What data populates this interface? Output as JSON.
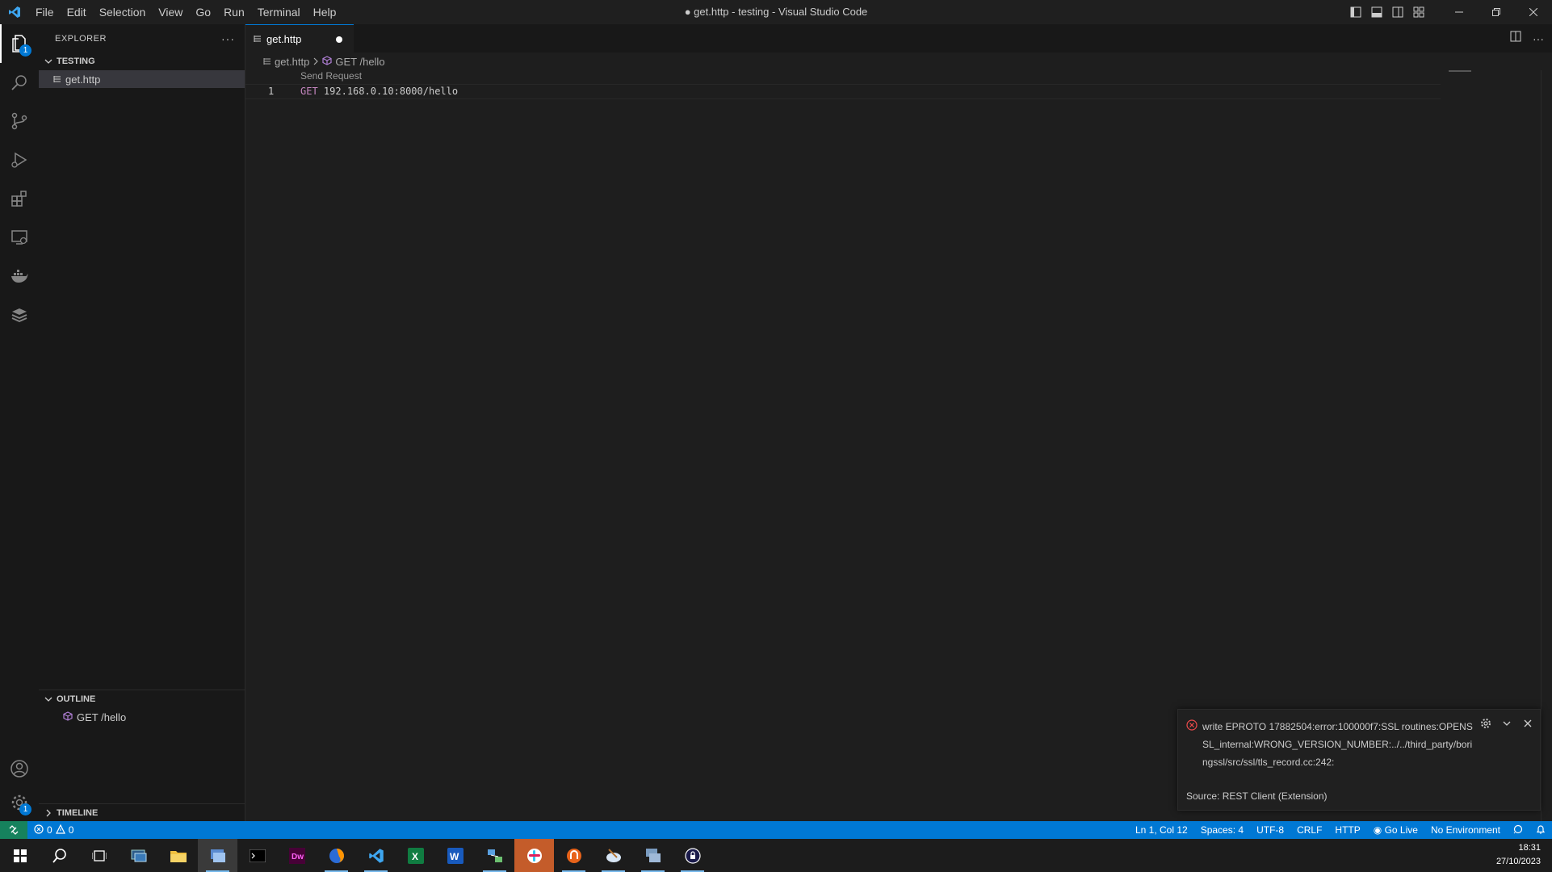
{
  "titlebar": {
    "menu": [
      "File",
      "Edit",
      "Selection",
      "View",
      "Go",
      "Run",
      "Terminal",
      "Help"
    ],
    "window_title": "● get.http - testing - Visual Studio Code",
    "window_controls": [
      "minimize-icon",
      "restore-icon",
      "close-icon"
    ]
  },
  "activitybar": {
    "items": [
      "explorer-icon",
      "search-icon",
      "source-control-icon",
      "run-debug-icon",
      "extensions-icon",
      "remote-explorer-icon",
      "docker-icon",
      "database-icon"
    ],
    "explorer_badge": "1",
    "accounts_icon": "accounts-icon",
    "manage_badge": "1"
  },
  "sidebar": {
    "title": "EXPLORER",
    "more": "···",
    "folder": "TESTING",
    "files": [
      "get.http"
    ],
    "outline_title": "OUTLINE",
    "outline_items": [
      "GET /hello"
    ],
    "timeline_title": "TIMELINE"
  },
  "tabs": [
    {
      "label": "get.http",
      "dirty": true
    }
  ],
  "breadcrumb": {
    "file": "get.http",
    "symbol": "GET /hello"
  },
  "editor": {
    "codelens": "Send Request",
    "lines": [
      {
        "number": "1",
        "method": "GET",
        "url": "192.168.0.10:8000/hello"
      }
    ]
  },
  "notification": {
    "message": "write EPROTO 17882504:error:100000f7:SSL routines:OPENSSL_internal:WRONG_VERSION_NUMBER:../../third_party/boringssl/src/ssl/tls_record.cc:242:",
    "source": "Source: REST Client (Extension)"
  },
  "statusbar": {
    "errors": "0",
    "warnings": "0",
    "position": "Ln 1, Col 12",
    "spaces": "Spaces: 4",
    "encoding": "UTF-8",
    "eol": "CRLF",
    "language": "HTTP",
    "golive": "Go Live",
    "environment": "No Environment"
  },
  "taskbar": {
    "apps": [
      "windows-start-icon",
      "search-icon",
      "task-view-icon",
      "remote-desktop-icon",
      "file-explorer-icon",
      "vscode-active-window-icon",
      "terminal-icon",
      "dreamweaver-icon",
      "firefox-icon",
      "vscode-icon",
      "excel-icon",
      "word-icon",
      "network-icon",
      "slack-icon",
      "app-icon",
      "paint-icon",
      "server-manager-icon",
      "vpn-icon"
    ],
    "time": "18:31",
    "date": "27/10/2023"
  },
  "colors": {
    "accent": "#0078d4",
    "error": "#f14c4c",
    "keyword": "#c586c0"
  }
}
